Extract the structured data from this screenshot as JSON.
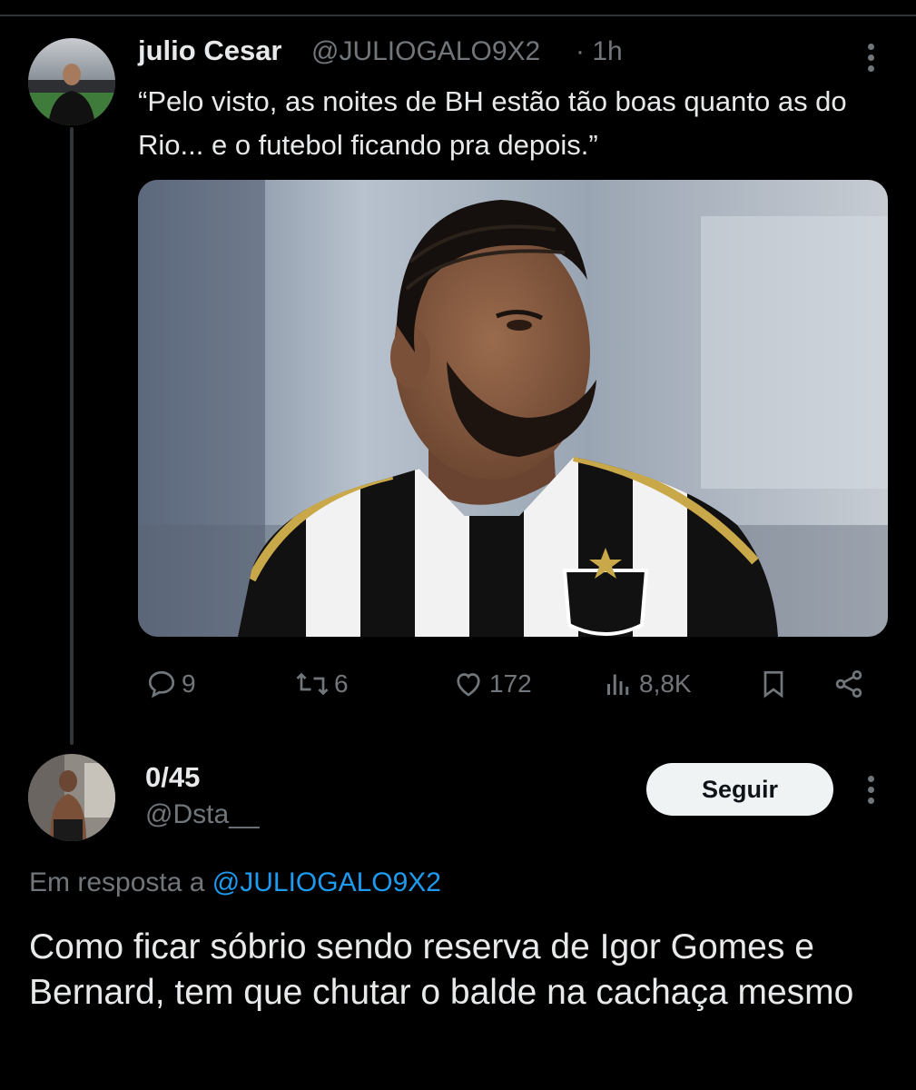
{
  "tweet": {
    "author_name": "julio Cesar",
    "handle": "@JULIOGALO9X2",
    "time": "· 1h",
    "text": "“Pelo visto, as noites de BH estão tão boas quanto as do Rio... e o futebol ficando pra depois.”",
    "image_alt": "player-photo",
    "stats": {
      "replies": "9",
      "reposts": "6",
      "likes": "172",
      "views": "8,8K"
    }
  },
  "reply": {
    "author_name": "0/45",
    "handle": "@Dsta__",
    "follow_label": "Seguir",
    "replying_prefix": "Em resposta a",
    "replying_to": "@JULIOGALO9X2",
    "text": "Como ficar sóbrio sendo reserva de Igor Gomes e Bernard, tem que chutar o balde na cachaça mesmo"
  },
  "icons": [
    "reply-icon",
    "repost-icon",
    "like-icon",
    "views-icon",
    "bookmark-icon",
    "share-icon",
    "more-icon"
  ],
  "colors": {
    "background": "#000000",
    "text": "#e7e9ea",
    "muted": "#71767b",
    "link": "#1d9bf0",
    "button_bg": "#eff3f4"
  }
}
